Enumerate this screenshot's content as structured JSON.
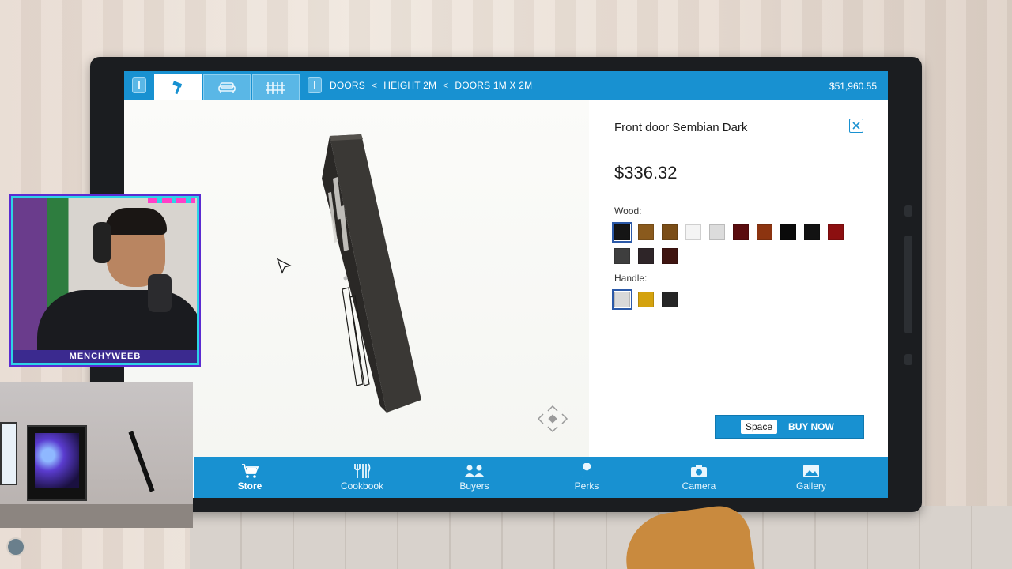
{
  "breadcrumb": {
    "items": [
      "DOORS",
      "HEIGHT 2M",
      "DOORS 1M X 2M"
    ],
    "separator": "<"
  },
  "balance": "$51,960.55",
  "toolbar_tabs": [
    {
      "icon": "hammer-icon",
      "active": true
    },
    {
      "icon": "sofa-icon",
      "active": false
    },
    {
      "icon": "fence-icon",
      "active": false
    }
  ],
  "product": {
    "name": "Front door Sembian Dark",
    "price": "$336.32",
    "wood_label": "Wood:",
    "handle_label": "Handle:",
    "wood_colors": [
      "#151515",
      "#8a5a1d",
      "#7a4d17",
      "#f4f4f4",
      "#dcdcdc",
      "#5a0c0e",
      "#8c3410",
      "#0a0a0a",
      "#121212",
      "#8c0f10",
      "#3e3e3e",
      "#2e2528",
      "#3f1510"
    ],
    "handle_colors": [
      "#d9d9d9",
      "#d4a20e",
      "#262626"
    ],
    "selected_wood": 0,
    "selected_handle": 0
  },
  "buy": {
    "key": "Space",
    "label": "BUY NOW"
  },
  "nav": [
    {
      "label": "Store",
      "icon": "cart-icon",
      "active": true
    },
    {
      "label": "Cookbook",
      "icon": "cutlery-icon",
      "active": false
    },
    {
      "label": "Buyers",
      "icon": "people-icon",
      "active": false
    },
    {
      "label": "Perks",
      "icon": "wrench-icon",
      "active": false
    },
    {
      "label": "Camera",
      "icon": "camera-icon",
      "active": false
    },
    {
      "label": "Gallery",
      "icon": "image-icon",
      "active": false
    }
  ],
  "streamer": {
    "name": "MENCHYWEEB"
  },
  "colors": {
    "accent": "#1891d1",
    "accent_light": "#5ab7e6",
    "overlay_border": "#2dd3e6"
  }
}
